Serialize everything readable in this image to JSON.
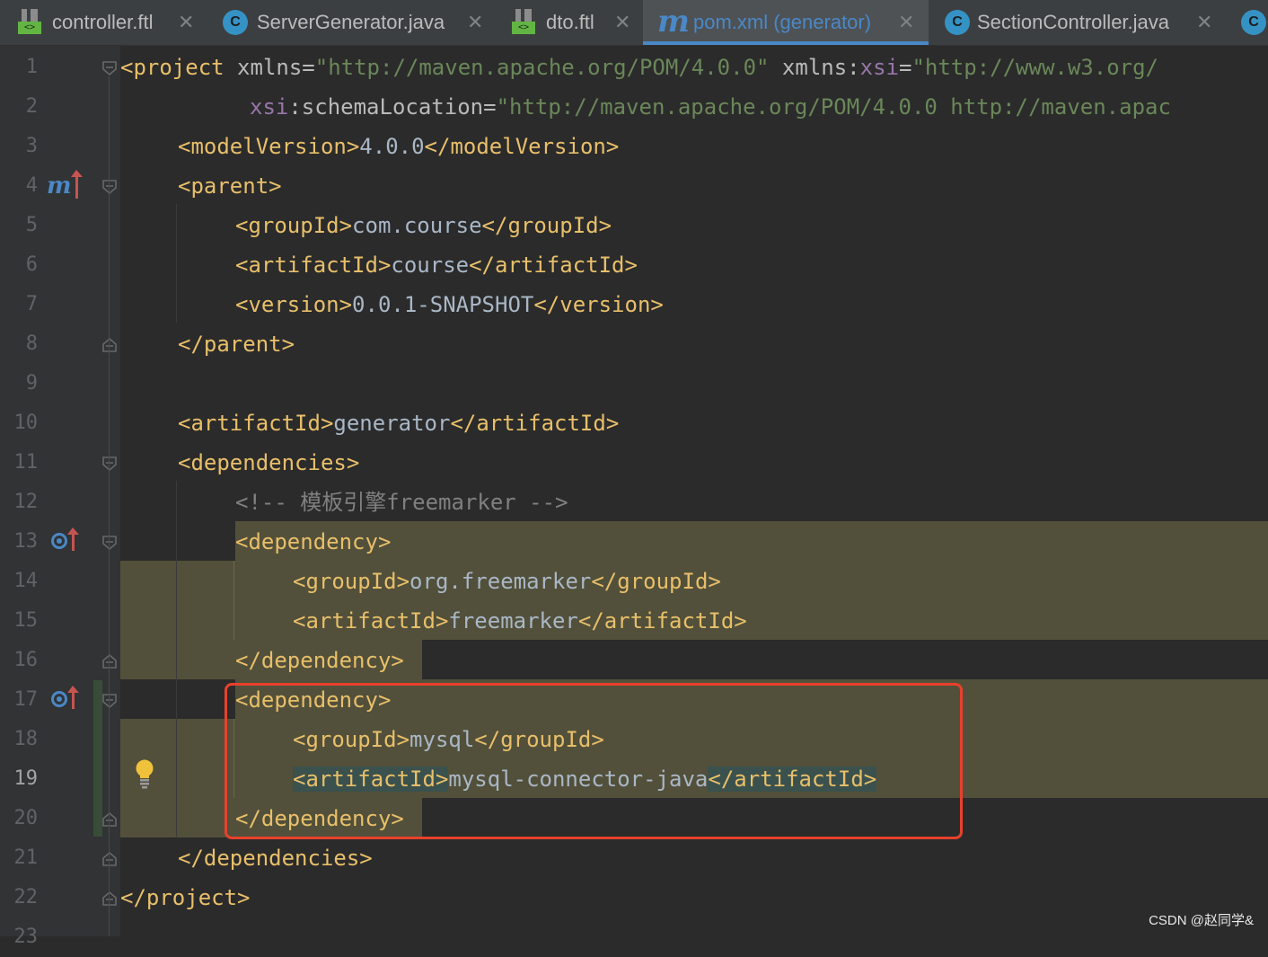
{
  "tabs": [
    {
      "label": "controller.ftl",
      "icon": "ftl-template-icon",
      "active": false
    },
    {
      "label": "ServerGenerator.java",
      "icon": "java-class-icon",
      "active": false
    },
    {
      "label": "dto.ftl",
      "icon": "ftl-template-icon",
      "active": false
    },
    {
      "label": "pom.xml (generator)",
      "icon": "maven-icon",
      "active": true
    },
    {
      "label": "SectionController.java",
      "icon": "java-class-icon",
      "active": false
    }
  ],
  "tab_close_glyph": "✕",
  "gutter": {
    "line_numbers": [
      "1",
      "2",
      "3",
      "4",
      "5",
      "6",
      "7",
      "8",
      "9",
      "10",
      "11",
      "12",
      "13",
      "14",
      "15",
      "16",
      "17",
      "18",
      "19",
      "20",
      "21",
      "22",
      "23"
    ],
    "current_line": "19",
    "maven_marker": "m"
  },
  "code": {
    "line1": {
      "open": "<project ",
      "attr1": "xmlns",
      "eq1": "=",
      "val1": "\"http://maven.apache.org/POM/4.0.0\"",
      "attr2": " xmlns:",
      "ns2": "xsi",
      "eq2": "=",
      "val2": "\"http://www.w3.org/"
    },
    "line2": {
      "ns": "xsi",
      "attr": ":schemaLocation",
      "eq": "=",
      "val": "\"http://maven.apache.org/POM/4.0.0 http://maven.apac"
    },
    "line3": {
      "open": "<modelVersion>",
      "text": "4.0.0",
      "close": "</modelVersion>"
    },
    "line4": {
      "tag": "<parent>"
    },
    "line5": {
      "open": "<groupId>",
      "text": "com.course",
      "close": "</groupId>"
    },
    "line6": {
      "open": "<artifactId>",
      "text": "course",
      "close": "</artifactId>"
    },
    "line7": {
      "open": "<version>",
      "text": "0.0.1-SNAPSHOT",
      "close": "</version>"
    },
    "line8": {
      "tag": "</parent>"
    },
    "line10": {
      "open": "<artifactId>",
      "text": "generator",
      "close": "</artifactId>"
    },
    "line11": {
      "tag": "<dependencies>"
    },
    "line12": {
      "comment": "<!-- 模板引擎freemarker -->"
    },
    "line13": {
      "tag": "<dependency>"
    },
    "line14": {
      "open": "<groupId>",
      "text": "org.freemarker",
      "close": "</groupId>"
    },
    "line15": {
      "open": "<artifactId>",
      "text": "freemarker",
      "close": "</artifactId>"
    },
    "line16": {
      "tag": "</dependency>"
    },
    "line17": {
      "tag": "<dependency>"
    },
    "line18": {
      "open": "<groupId>",
      "text": "mysql",
      "close": "</groupId>"
    },
    "line19": {
      "open": "<artifactId>",
      "text": "mysql-connector-java",
      "close": "</artifactId>"
    },
    "line20": {
      "tag": "</dependency>"
    },
    "line21": {
      "tag": "</dependencies>"
    },
    "line22": {
      "tag": "</project>"
    }
  },
  "watermark": "CSDN @赵同学&",
  "colors": {
    "background": "#2b2b2b",
    "gutter": "#313335",
    "tag": "#e8bf6a",
    "attribute": "#bababa",
    "namespace": "#9876aa",
    "string": "#6a8759",
    "comment": "#808080",
    "text": "#a9b7c6",
    "highlight": "#52503a",
    "annotation_box": "#e8412c",
    "active_tab_underline": "#4a88c7"
  }
}
